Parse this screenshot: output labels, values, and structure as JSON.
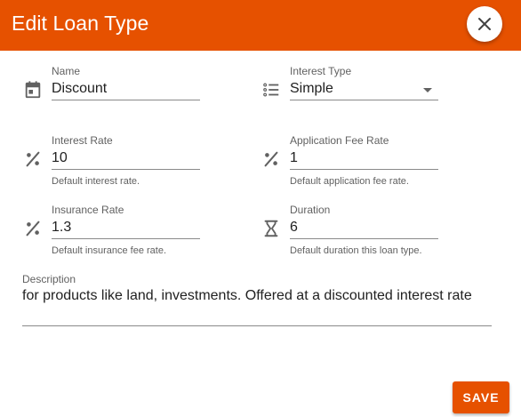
{
  "dialog": {
    "title": "Edit Loan Type",
    "close_icon": "close-icon",
    "save_label": "SAVE",
    "accent_color": "#e65100"
  },
  "fields": {
    "name": {
      "label": "Name",
      "value": "Discount",
      "icon": "calendar-icon"
    },
    "interest_type": {
      "label": "Interest Type",
      "value": "Simple",
      "icon": "list-icon"
    },
    "interest_rate": {
      "label": "Interest Rate",
      "value": "10",
      "hint": "Default interest rate.",
      "icon": "percent-icon"
    },
    "application_fee_rate": {
      "label": "Application Fee Rate",
      "value": "1",
      "hint": "Default application fee rate.",
      "icon": "percent-icon"
    },
    "insurance_rate": {
      "label": "Insurance Rate",
      "value": "1.3",
      "hint": "Default insurance fee rate.",
      "icon": "percent-icon"
    },
    "duration": {
      "label": "Duration",
      "value": "6",
      "hint": "Default duration this loan type.",
      "icon": "hourglass-icon"
    },
    "description": {
      "label": "Description",
      "value": "for products like land, investments. Offered at a discounted interest rate"
    }
  }
}
